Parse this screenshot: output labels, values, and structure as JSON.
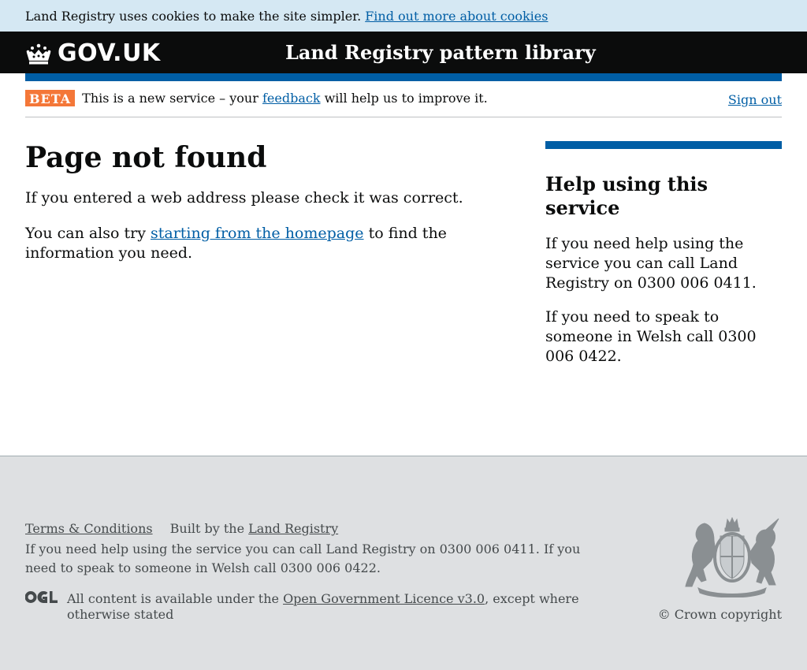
{
  "cookie_banner": {
    "text": "Land Registry uses cookies to make the site simpler.",
    "link": "Find out more about cookies"
  },
  "header": {
    "logo_text": "GOV.UK",
    "service_name": "Land Registry pattern library"
  },
  "phase_banner": {
    "tag": "BETA",
    "text_before": "This is a new service – your",
    "feedback_link": "feedback",
    "text_after": "will help us to improve it.",
    "sign_out": "Sign out"
  },
  "main": {
    "title": "Page not found",
    "para1": "If you entered a web address please check it was correct.",
    "para2_before": "You can also try",
    "para2_link": "starting from the homepage",
    "para2_after": "to find the information you need."
  },
  "aside": {
    "title": "Help using this service",
    "p1": "If you need help using the service you can call Land Registry on 0300 006 0411.",
    "p2": "If you need to speak to someone in Welsh call 0300 006 0422."
  },
  "footer": {
    "terms": "Terms & Conditions",
    "built_by": "Built by the",
    "built_by_link": "Land Registry",
    "help_text": "If you need help using the service you can call Land Registry on 0300 006 0411. If you need to speak to someone in Welsh call 0300 006 0422.",
    "licence_before": "All content is available under the",
    "licence_link": "Open Government Licence v3.0",
    "licence_after": ", except where otherwise stated",
    "copyright": "© Crown copyright"
  },
  "colors": {
    "brand_blue": "#005ea5",
    "beta_orange": "#f47738",
    "header_black": "#0b0c0c",
    "cookie_bg": "#d5e8f3",
    "footer_bg": "#dee0e2"
  },
  "icons": {
    "logo": "crown-icon",
    "licence": "ogl-logo",
    "crest": "royal-coat-of-arms"
  }
}
